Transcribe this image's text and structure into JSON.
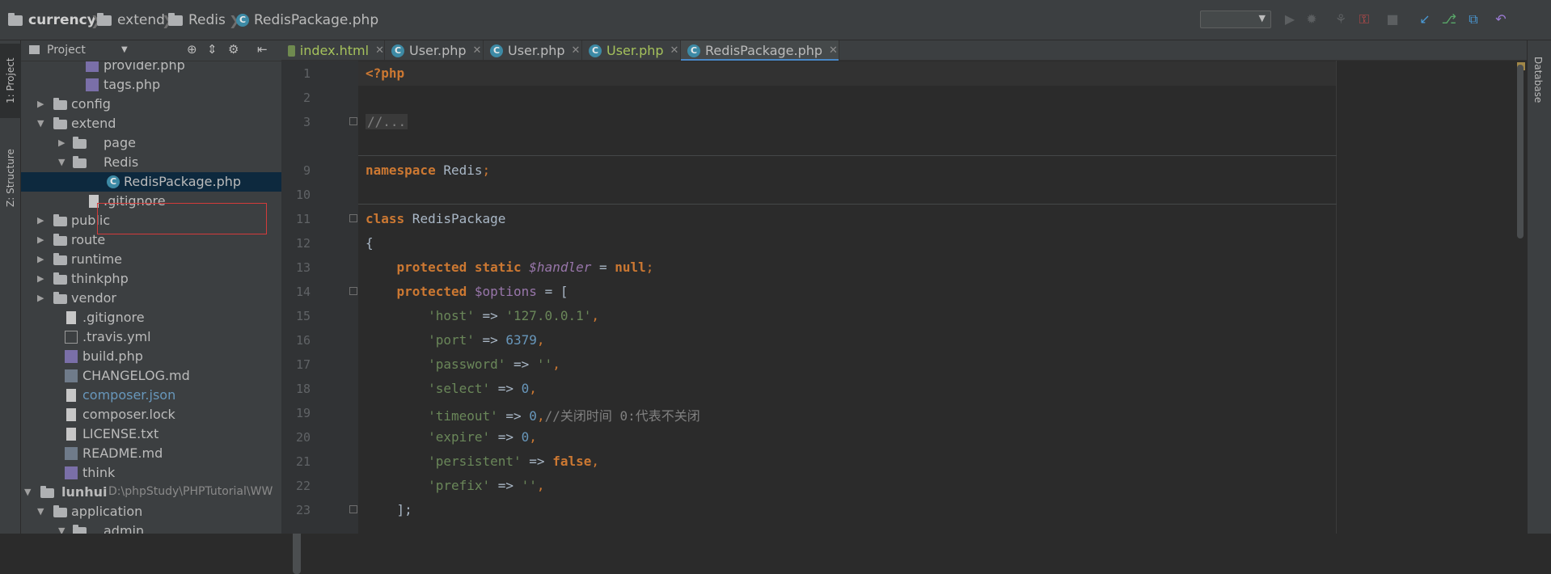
{
  "breadcrumbs": [
    "currency",
    "extend",
    "Redis",
    "RedisPackage.php"
  ],
  "toolbar": {
    "run_config_value": "",
    "icons": [
      "run-icon",
      "debug-icon",
      "coverage-icon",
      "profile-icon",
      "stop-icon",
      "vcs-update-icon",
      "vcs-commit-icon",
      "vcs-compare-icon",
      "revert-icon"
    ]
  },
  "left_stripe": {
    "project_tab": "1: Project",
    "structure_tab": "Z: Structure"
  },
  "right_stripe": {
    "database_tab": "Database"
  },
  "project_panel": {
    "title": "Project",
    "tree": [
      {
        "label": "provider.php",
        "type": "php"
      },
      {
        "label": "tags.php",
        "type": "php"
      },
      {
        "label": "config",
        "type": "folder"
      },
      {
        "label": "extend",
        "type": "folder"
      },
      {
        "label": "page",
        "type": "folder"
      },
      {
        "label": "Redis",
        "type": "folder"
      },
      {
        "label": "RedisPackage.php",
        "type": "class"
      },
      {
        "label": ".gitignore",
        "type": "text"
      },
      {
        "label": "public",
        "type": "folder"
      },
      {
        "label": "route",
        "type": "folder"
      },
      {
        "label": "runtime",
        "type": "folder"
      },
      {
        "label": "thinkphp",
        "type": "folder"
      },
      {
        "label": "vendor",
        "type": "folder"
      },
      {
        "label": ".gitignore",
        "type": "text"
      },
      {
        "label": ".travis.yml",
        "type": "yml"
      },
      {
        "label": "build.php",
        "type": "php"
      },
      {
        "label": "CHANGELOG.md",
        "type": "md"
      },
      {
        "label": "composer.json",
        "type": "json"
      },
      {
        "label": "composer.lock",
        "type": "text"
      },
      {
        "label": "LICENSE.txt",
        "type": "text"
      },
      {
        "label": "README.md",
        "type": "md"
      },
      {
        "label": "think",
        "type": "php"
      },
      {
        "label": "lunhui",
        "type": "folder",
        "path": "D:\\phpStudy\\PHPTutorial\\WW"
      },
      {
        "label": "application",
        "type": "folder"
      },
      {
        "label": "admin",
        "type": "folder"
      }
    ]
  },
  "editor": {
    "tabs": [
      {
        "label": "index.html",
        "kind": "html"
      },
      {
        "label": "User.php",
        "kind": "class"
      },
      {
        "label": "User.php",
        "kind": "class"
      },
      {
        "label": "User.php",
        "kind": "class"
      },
      {
        "label": "RedisPackage.php",
        "kind": "class",
        "active": true
      }
    ],
    "line_numbers": [
      "1",
      "2",
      "3",
      "9",
      "10",
      "11",
      "12",
      "13",
      "14",
      "15",
      "16",
      "17",
      "18",
      "19",
      "20",
      "21",
      "22",
      "23"
    ],
    "code": {
      "l1": "<?php",
      "l3": "//...",
      "l9_kw": "namespace",
      "l9_rest": " Redis",
      "l11_kw": "class",
      "l11_name": " RedisPackage",
      "l12": "{",
      "l13_kw": "protected static",
      "l13_var": "$handler",
      "l13_eq": " = ",
      "l13_val": "null",
      "l14_kw": "protected",
      "l14_var": "$options",
      "l14_eq": " = [",
      "opt_host_k": "'host'",
      "opt_host_v": "'127.0.0.1'",
      "opt_port_k": "'port'",
      "opt_port_v": "6379",
      "opt_pass_k": "'password'",
      "opt_pass_v": "''",
      "opt_select_k": "'select'",
      "opt_select_v": "0",
      "opt_timeout_k": "'timeout'",
      "opt_timeout_v": "0",
      "opt_timeout_cmt": "//关闭时间 0:代表不关闭",
      "opt_expire_k": "'expire'",
      "opt_expire_v": "0",
      "opt_persist_k": "'persistent'",
      "opt_persist_v": "false",
      "opt_prefix_k": "'prefix'",
      "opt_prefix_v": "''",
      "arrow": " => ",
      "l23": "];"
    }
  }
}
